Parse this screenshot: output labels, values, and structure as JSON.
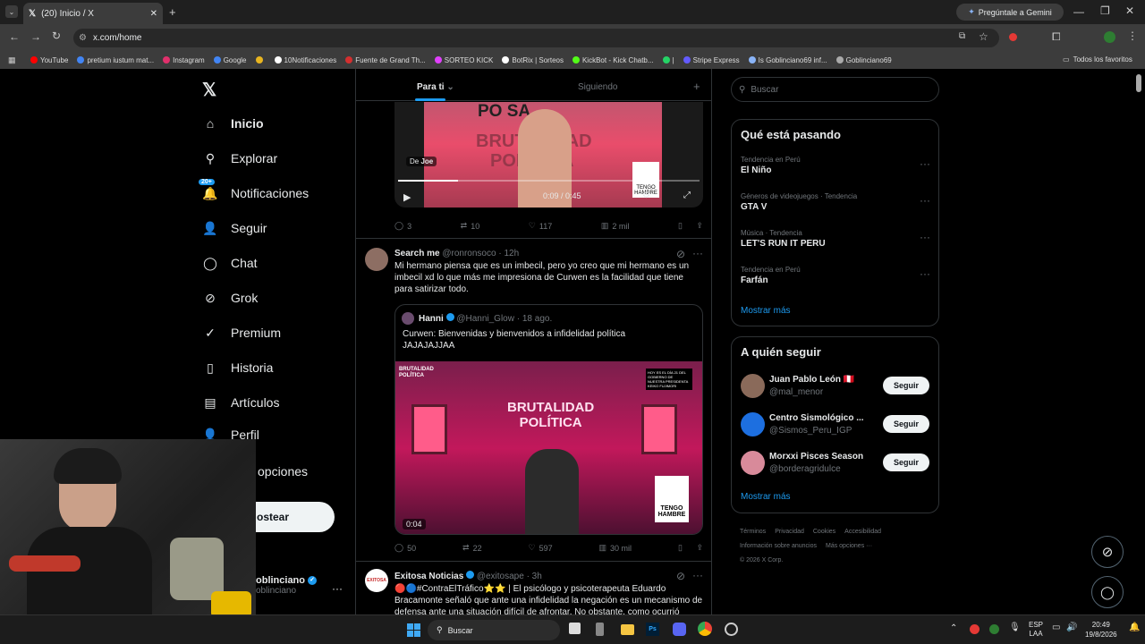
{
  "browser": {
    "tab_title": "(20) Inicio / X",
    "url": "x.com/home",
    "gemini": "Pregúntale a Gemini",
    "all_bookmarks": "Todos los favoritos",
    "bookmarks": [
      {
        "label": "YouTube",
        "color": "#ff0000"
      },
      {
        "label": "pretium iustum mat...",
        "color": "#4285f4"
      },
      {
        "label": "Instagram",
        "color": "#e1306c"
      },
      {
        "label": "Google",
        "color": "#4285f4"
      },
      {
        "label": "",
        "color": "#e8b520"
      },
      {
        "label": "10Notificaciones",
        "color": "#ffffff"
      },
      {
        "label": "Fuente de Grand Th...",
        "color": "#d32f2f"
      },
      {
        "label": "SORTEO KICK",
        "color": "#e040fb"
      },
      {
        "label": "BotRix | Sorteos",
        "color": "#ffffff"
      },
      {
        "label": "KickBot - Kick Chatb...",
        "color": "#53fc18"
      },
      {
        "label": "|",
        "color": "#25d366"
      },
      {
        "label": "Stripe Express",
        "color": "#635bff"
      },
      {
        "label": "Is Goblinciano69 inf...",
        "color": "#8ab4f8"
      },
      {
        "label": "Goblinciano69",
        "color": "#aaaaaa"
      }
    ]
  },
  "nav": {
    "items": [
      {
        "label": "Inicio",
        "icon": "home-icon",
        "badge": ""
      },
      {
        "label": "Explorar",
        "icon": "search-icon",
        "badge": ""
      },
      {
        "label": "Notificaciones",
        "icon": "bell-icon",
        "badge": "20+"
      },
      {
        "label": "Seguir",
        "icon": "follow-icon",
        "badge": ""
      },
      {
        "label": "Chat",
        "icon": "chat-icon",
        "badge": ""
      },
      {
        "label": "Grok",
        "icon": "grok-icon",
        "badge": ""
      },
      {
        "label": "Premium",
        "icon": "premium-icon",
        "badge": ""
      },
      {
        "label": "Historia",
        "icon": "bookmark-icon",
        "badge": ""
      },
      {
        "label": "Artículos",
        "icon": "articles-icon",
        "badge": ""
      },
      {
        "label": "Perfil",
        "icon": "profile-icon",
        "badge": ""
      },
      {
        "label": "opciones",
        "icon": "more-icon",
        "badge": ""
      }
    ],
    "post_button": "ostear",
    "account_name": "oblinciano",
    "account_handle": "oblinciano"
  },
  "feed": {
    "tabs": [
      "Para ti",
      "Siguiendo"
    ],
    "video": {
      "via": "De",
      "via_name": "Joe",
      "time": "0:09 / 0:45",
      "overlay_top": "PO   SA",
      "overlay_mid": "BRUTALIDAD",
      "overlay_low": "POLÍTICA",
      "qr_text": "TENGO HAMBRE"
    },
    "tweet0_actions": {
      "replies": "3",
      "reposts": "10",
      "likes": "117",
      "views": "2 mil"
    },
    "tweet1": {
      "name": "Search me",
      "handle": "@ronronsoco",
      "time": "· 12h",
      "text": "Mi hermano piensa que es un imbecil, pero yo creo que mi hermano es un imbecil xd lo que más me impresiona de Curwen es la facilidad que tiene para satirizar todo.",
      "quote": {
        "name": "Hanni",
        "handle": "@Hanni_Glow",
        "time": "· 18 ago.",
        "text": "Curwen: Bienvenidas y bienvenidos  a infidelidad política JAJAJAJJAA",
        "video_time": "0:04",
        "sign_top": "BRUTALIDAD",
        "sign_low": "POLÍTICA",
        "corner": "BRUTALIDAD POLÍTICA",
        "news": "HOY ES EL DÍA 21 DEL GOBIERNO DE NUESTRA PRESIDENTA KEIKO FUJIMORI",
        "qr_text": "TENGO HAMBRE"
      },
      "actions": {
        "replies": "50",
        "reposts": "22",
        "likes": "597",
        "views": "30 mil"
      }
    },
    "tweet2": {
      "name": "Exitosa Noticias",
      "handle": "@exitosape",
      "time": "· 3h",
      "logo": "EXITOSA",
      "text": "🔴🔵#ContraElTráfico⭐⭐ | El psicólogo y psicoterapeuta Eduardo Bracamonte señaló que ante una infidelidad la negación es un mecanismo de defensa ante una situación difícil de afrontar. No obstante, como ocurrió"
    }
  },
  "right": {
    "search_placeholder": "Buscar",
    "trends_title": "Qué está pasando",
    "trends": [
      {
        "meta": "Tendencia en Perú",
        "name": "El Niño"
      },
      {
        "meta": "Géneros de videojuegos · Tendencia",
        "name": "GTA V"
      },
      {
        "meta": "Música · Tendencia",
        "name": "LET'S RUN IT PERU"
      },
      {
        "meta": "Tendencia en Perú",
        "name": "Farfán"
      }
    ],
    "show_more": "Mostrar más",
    "follow_title": "A quién seguir",
    "follow": [
      {
        "name": "Juan Pablo León 🇵🇪",
        "handle": "@mal_menor",
        "color": "#8a6a5a"
      },
      {
        "name": "Centro Sismológico ...",
        "handle": "@Sismos_Peru_IGP",
        "color": "#1d6fe0"
      },
      {
        "name": "Morxxi Pisces Season",
        "handle": "@borderagridulce",
        "color": "#d88a9a"
      }
    ],
    "follow_btn": "Seguir",
    "follow_more": "Mostrar más",
    "footer": {
      "links": [
        "Términos",
        "Privacidad",
        "Cookies",
        "Accesibilidad",
        "Información sobre anuncios",
        "Más opciones ···"
      ],
      "copyright": "© 2026 X Corp."
    }
  },
  "taskbar": {
    "search": "Buscar",
    "lang1": "ESP",
    "lang2": "LAA",
    "time": "20:49",
    "date": "19/8/2026"
  }
}
